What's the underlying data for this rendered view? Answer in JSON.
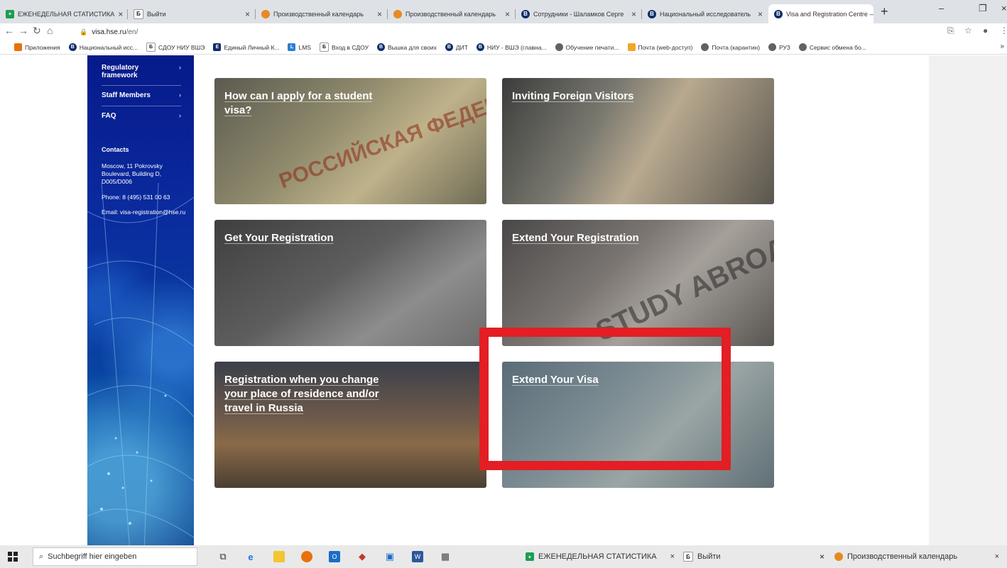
{
  "browser": {
    "tabs": [
      {
        "label": "ЕЖЕНЕДЕЛЬНАЯ СТАТИСТИКА",
        "icon": "sheets-icon"
      },
      {
        "label": "Выйти",
        "icon": "hse-letter-icon"
      },
      {
        "label": "Производственный календарь",
        "icon": "orange-avatar-icon"
      },
      {
        "label": "Производственный календарь",
        "icon": "orange-avatar-icon"
      },
      {
        "label": "Сотрудники - Шаламков Серге",
        "icon": "hse-icon"
      },
      {
        "label": "Национальный исследователь",
        "icon": "hse-icon"
      },
      {
        "label": "Visa and Registration Centre — I",
        "icon": "hse-icon",
        "active": true
      }
    ],
    "url_host": "visa.hse.ru",
    "url_path": "/en/",
    "bookmarks": [
      "Приложения",
      "Национальный исс...",
      "СДОУ НИУ ВШЭ",
      "Единый Личный К...",
      "LMS",
      "Вход в СДОУ",
      "Вышка для своих",
      "ДИТ",
      "НИУ - ВШЭ (главна...",
      "Обучение печати...",
      "Почта (web-доступ)",
      "Почта (карантин)",
      "РУЗ",
      "Сервис обмена бо..."
    ]
  },
  "sidebar": {
    "items": [
      {
        "label": "Regulatory framework"
      },
      {
        "label": "Staff Members"
      },
      {
        "label": "FAQ"
      }
    ],
    "contacts_heading": "Contacts",
    "address": "Moscow, 11 Pokrovsky Boulevard, Building D, D005/D006",
    "phone": "Phone: 8 (495) 531 00 63",
    "email": "Email: visa-registration@hse.ru"
  },
  "cards": [
    {
      "title": "How can I apply for a student visa?"
    },
    {
      "title": "Inviting Foreign Visitors"
    },
    {
      "title": "Get Your Registration"
    },
    {
      "title": "Extend Your Registration"
    },
    {
      "title": "Registration when you change your place of residence and/or travel in Russia"
    },
    {
      "title": "Extend Your Visa"
    }
  ],
  "highlight_color": "#e31e24",
  "taskbar": {
    "search_placeholder": "Suchbegriff hier eingeben",
    "windows": [
      {
        "label": "ЕЖЕНЕДЕЛЬНАЯ СТАТИСТИКА"
      },
      {
        "label": "Выйти"
      },
      {
        "label": "Производственный календарь"
      }
    ]
  }
}
